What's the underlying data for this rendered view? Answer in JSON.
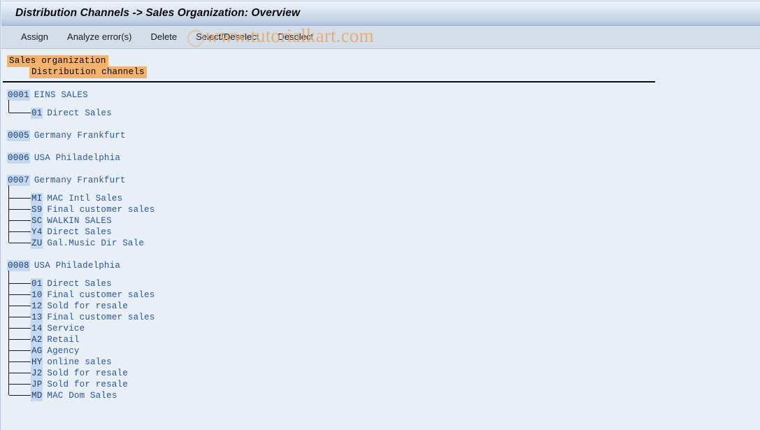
{
  "window": {
    "title": "Distribution Channels -> Sales Organization: Overview"
  },
  "toolbar": {
    "buttons": [
      {
        "label": "Assign",
        "name": "assign-button"
      },
      {
        "label": "Analyze error(s)",
        "name": "analyze-errors-button"
      },
      {
        "label": "Delete",
        "name": "delete-button"
      },
      {
        "label": "Select/Deselect",
        "name": "select-deselect-button"
      },
      {
        "label": "Deselect",
        "name": "deselect-button"
      }
    ]
  },
  "watermark": {
    "text": "www.tutorialkart.com",
    "copyright_symbol": "c"
  },
  "legend": {
    "level1": "Sales organization",
    "level2": "Distribution channels"
  },
  "colors": {
    "titlebar_top": "#eef3f9",
    "titlebar_bottom": "#aabfd9",
    "toolbar_bg": "#d4dee9",
    "content_bg": "#e9eff6",
    "legend_chip_bg": "#f6b26b",
    "code_chip_bg": "#c5d8ee",
    "code_text": "#1c3f73",
    "label_text": "#2a5699",
    "watermark": "#e8a86a",
    "rule": "#0d0d0d"
  },
  "tree": [
    {
      "code": "0001",
      "label": "EINS SALES",
      "children": [
        {
          "code": "01",
          "label": "Direct Sales"
        }
      ]
    },
    {
      "code": "0005",
      "label": "Germany Frankfurt",
      "children": []
    },
    {
      "code": "0006",
      "label": "USA Philadelphia",
      "children": []
    },
    {
      "code": "0007",
      "label": "Germany Frankfurt",
      "children": [
        {
          "code": "MI",
          "label": "MAC Intl Sales"
        },
        {
          "code": "S9",
          "label": "Final customer sales"
        },
        {
          "code": "SC",
          "label": "WALKIN SALES"
        },
        {
          "code": "Y4",
          "label": "Direct Sales"
        },
        {
          "code": "ZU",
          "label": "Gal.Music Dir Sale"
        }
      ]
    },
    {
      "code": "0008",
      "label": "USA Philadelphia",
      "children": [
        {
          "code": "01",
          "label": "Direct Sales"
        },
        {
          "code": "10",
          "label": "Final customer sales"
        },
        {
          "code": "12",
          "label": "Sold for resale"
        },
        {
          "code": "13",
          "label": "Final customer sales"
        },
        {
          "code": "14",
          "label": "Service"
        },
        {
          "code": "A2",
          "label": "Retail"
        },
        {
          "code": "AG",
          "label": "Agency"
        },
        {
          "code": "HY",
          "label": "online sales"
        },
        {
          "code": "J2",
          "label": "Sold for resale"
        },
        {
          "code": "JP",
          "label": "Sold for resale"
        },
        {
          "code": "MD",
          "label": "MAC Dom Sales"
        }
      ]
    }
  ]
}
